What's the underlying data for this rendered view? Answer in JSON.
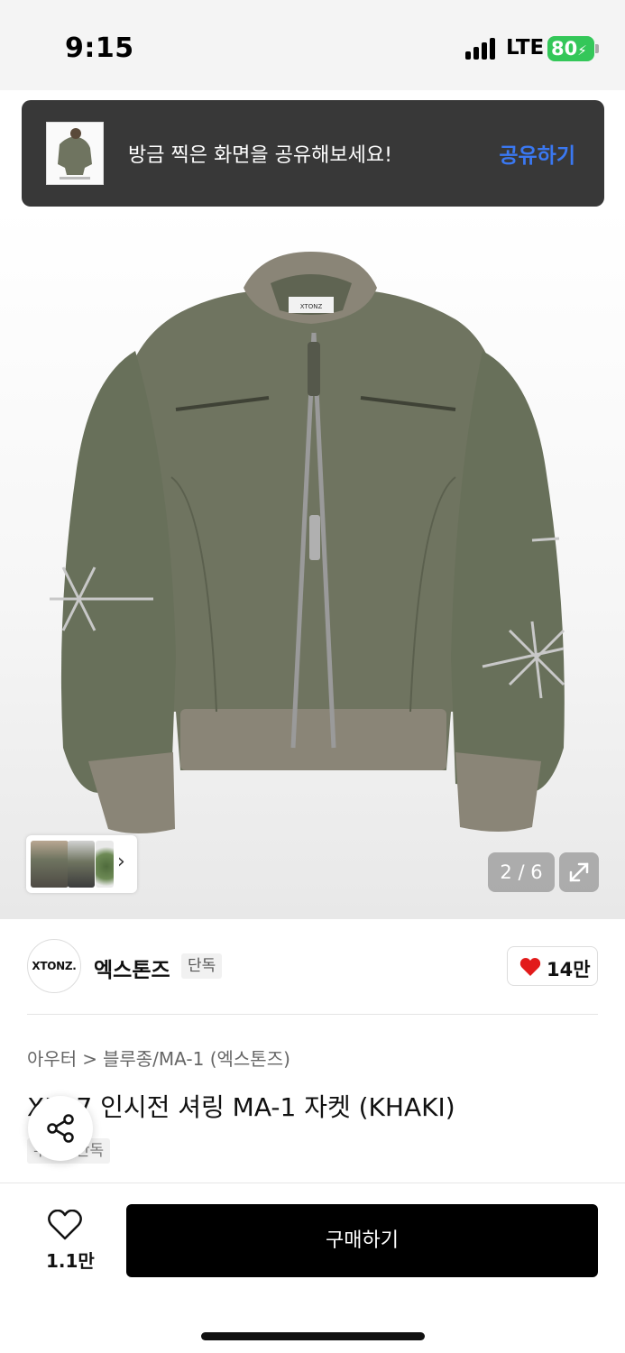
{
  "status_bar": {
    "time": "9:15",
    "network": "LTE",
    "battery": "80"
  },
  "share_banner": {
    "message": "방금 찍은 화면을 공유해보세요!",
    "action_label": "공유하기"
  },
  "gallery": {
    "counter": "2 / 6",
    "thumbnail_arrow": "›"
  },
  "brand": {
    "logo_text": "XTONZ.",
    "name": "엑스톤즈",
    "badge": "단독",
    "like_count": "14만"
  },
  "product": {
    "breadcrumb": [
      "아우터",
      "블루종/MA-1 (엑스톤즈)"
    ],
    "breadcrumb_separator": ">",
    "title": "XJ-07 인시전 셔링 MA-1 자켓 (KHAKI)",
    "tag": "무신사단독"
  },
  "bottom_bar": {
    "wish_count": "1.1만",
    "buy_label": "구매하기"
  },
  "colors": {
    "accent_blue": "#3a78f2",
    "banner_bg": "#383838",
    "battery_green": "#34c759",
    "heart_red": "#e21b1b",
    "jacket_khaki": "#6f7460"
  }
}
